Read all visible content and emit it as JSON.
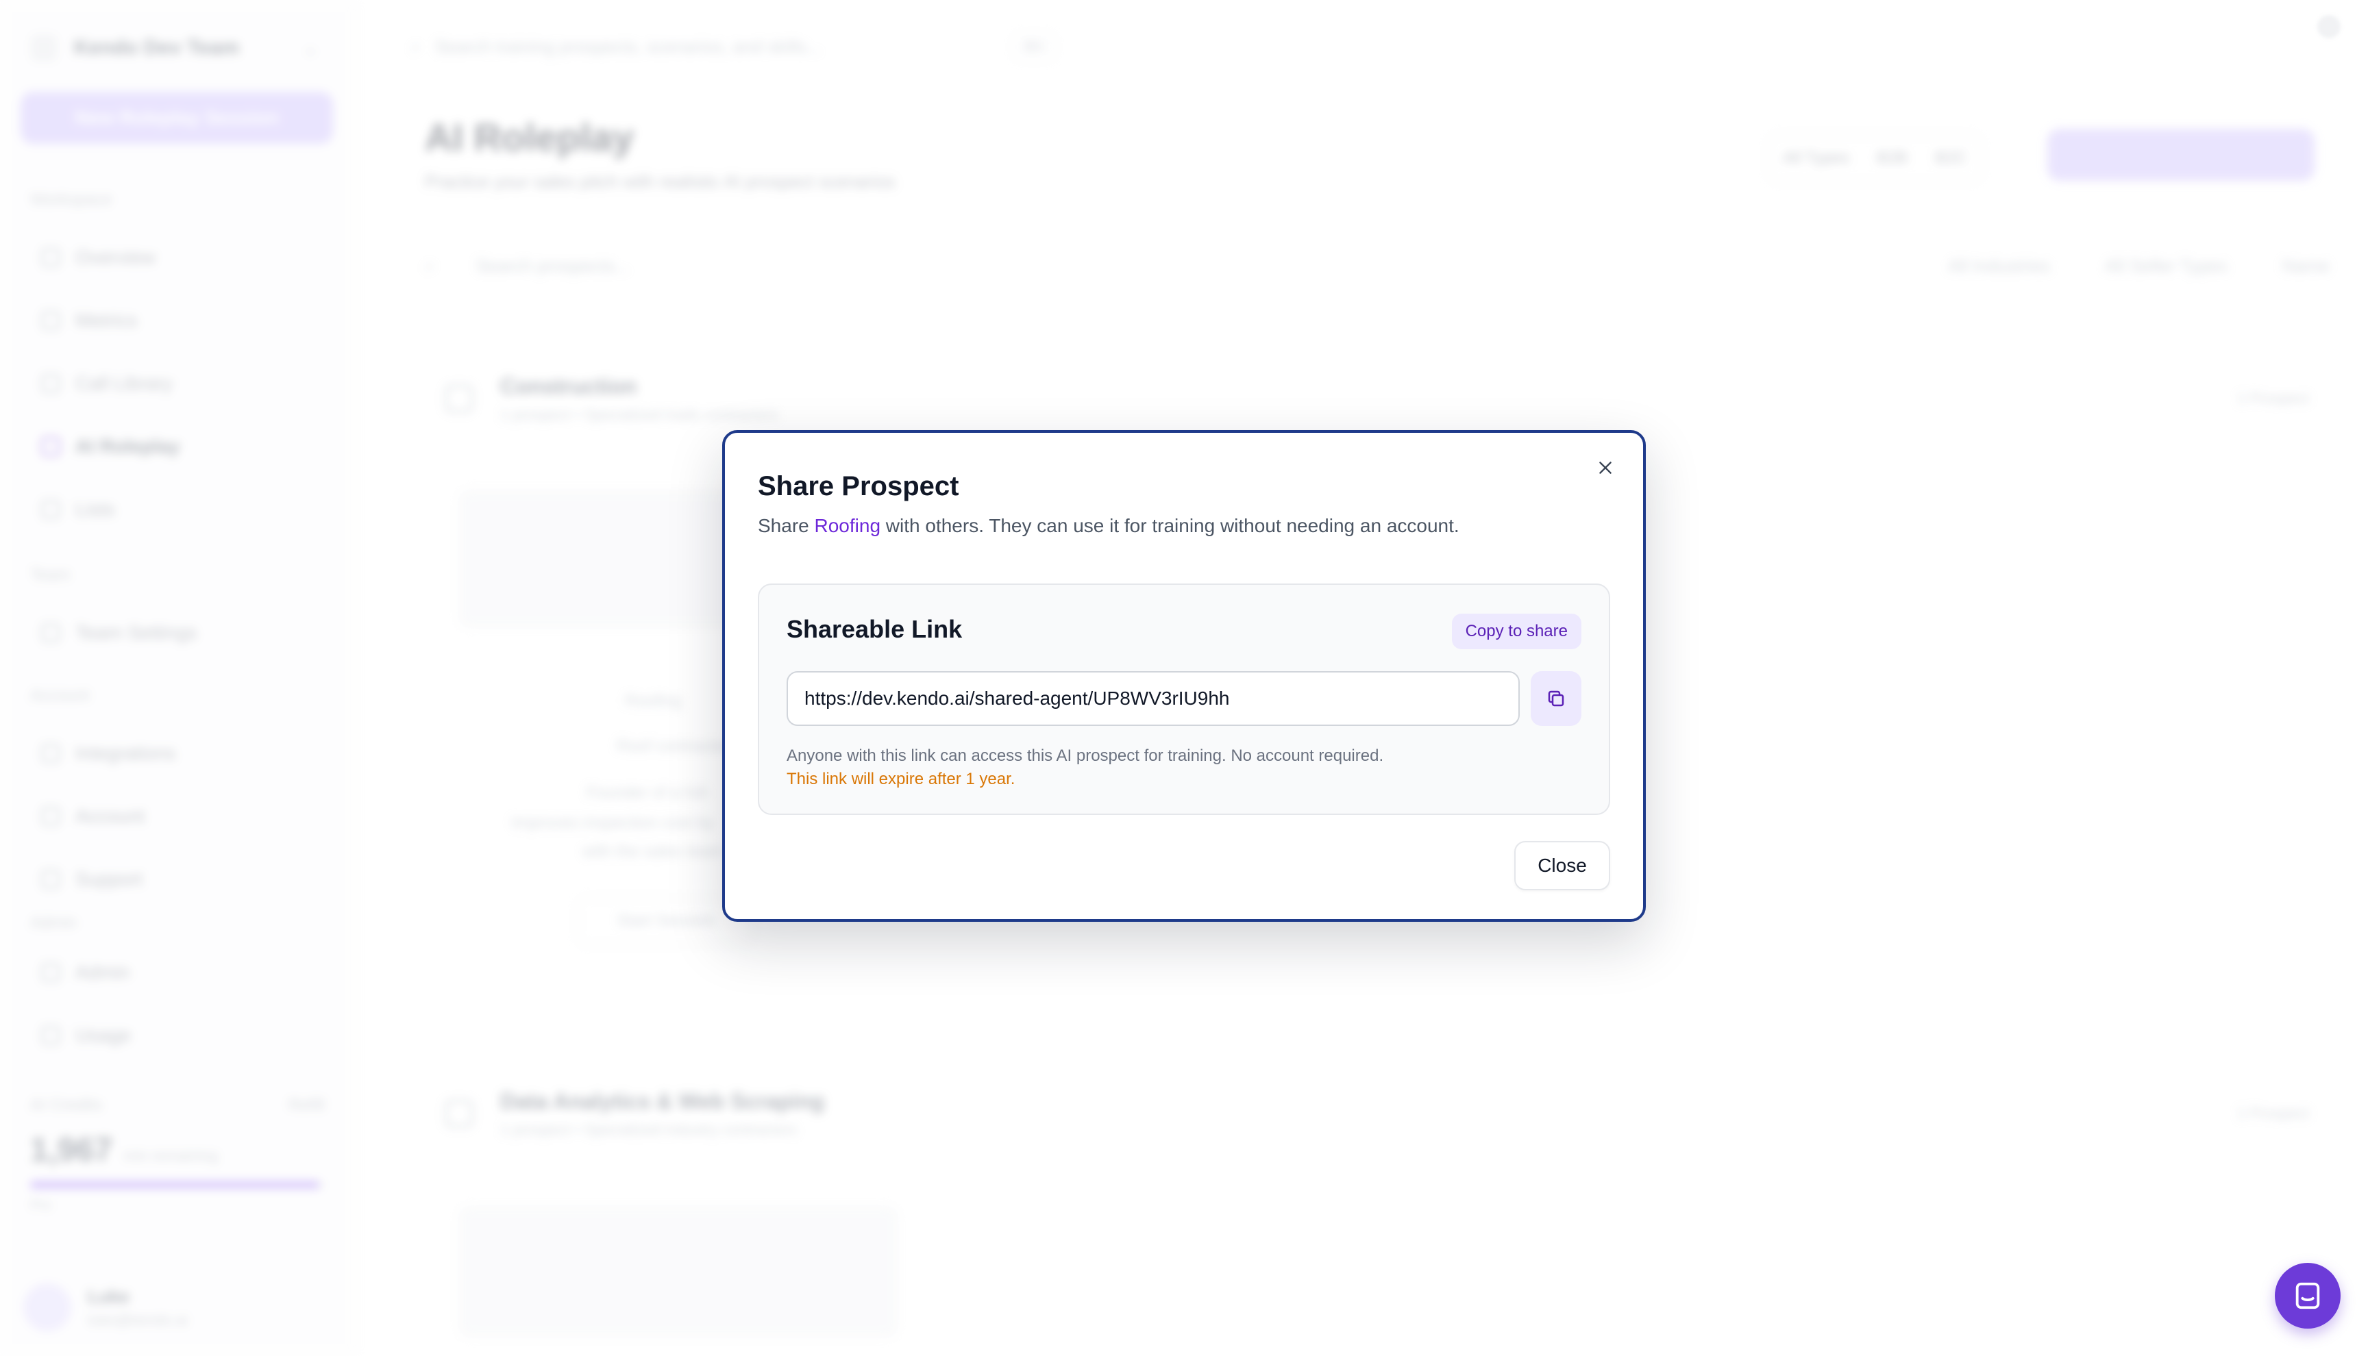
{
  "sidebar": {
    "team_name": "Kendo Dev Team",
    "new_button": "New Roleplay Session",
    "sections": [
      {
        "label": "Workspace"
      },
      {
        "label": "Team"
      },
      {
        "label": "Account"
      },
      {
        "label": "Admin"
      }
    ],
    "items": [
      {
        "label": "Overview"
      },
      {
        "label": "Metrics"
      },
      {
        "label": "Call Library"
      },
      {
        "label": "AI Roleplay"
      },
      {
        "label": "Lists"
      },
      {
        "label": "Team Settings"
      },
      {
        "label": "Integrations"
      },
      {
        "label": "Account"
      },
      {
        "label": "Support"
      },
      {
        "label": "Admin"
      },
      {
        "label": "Usage"
      }
    ],
    "credits": {
      "label": "AI Credits",
      "action": "Refill",
      "value": "1,967",
      "unit": "min remaining",
      "fill": 0.98,
      "sub": "Pro"
    },
    "user": {
      "name": "Luke",
      "email": "luke@kendo.ai"
    }
  },
  "main": {
    "search_placeholder": "Search training prospects, scenarios, and skills...",
    "search_shortcut": "⌘K",
    "title": "AI Roleplay",
    "subtitle": "Practice your sales pitch with realistic AI prospect scenarios",
    "segments": [
      "All Types",
      "B2B",
      "B2C"
    ],
    "filter_search": "Search prospects...",
    "filters": [
      "All Industries",
      "All Seller Types",
      "Name"
    ],
    "categories": [
      {
        "title": "Construction",
        "sub": "1 prospect • Specialized trade contractors",
        "right": "1 Prospect"
      },
      {
        "title": "Data Analytics & Web Scraping",
        "sub": "1 prospect • Specialized industry contractors",
        "right": "1 Prospect"
      }
    ],
    "card_name": "Roofing",
    "card_role": "Roof contractor",
    "card_desc_1": "Founder of a full-",
    "card_desc_2": "Improves inspection cost by",
    "card_desc_3": "with the sales team",
    "card_button": "Start Session"
  },
  "modal": {
    "title": "Share Prospect",
    "desc_prefix": "Share ",
    "desc_highlight": "Roofing",
    "desc_suffix": " with others. They can use it for training without needing an account.",
    "card_title": "Shareable Link",
    "copy_badge": "Copy to share",
    "url": "https://dev.kendo.ai/shared-agent/UP8WV3rIU9hh",
    "help_text": "Anyone with this link can access this AI prospect for training. No account required.",
    "warning_text": "This link will expire after 1 year.",
    "close_label": "Close"
  },
  "icons": {
    "close": "close-icon",
    "copy": "copy-icon",
    "chat": "chat-icon"
  },
  "colors": {
    "accent": "#6d28d9",
    "warning": "#d97706",
    "modal_border": "#1e3a8a",
    "chat_launcher": "#6d3bd8"
  }
}
